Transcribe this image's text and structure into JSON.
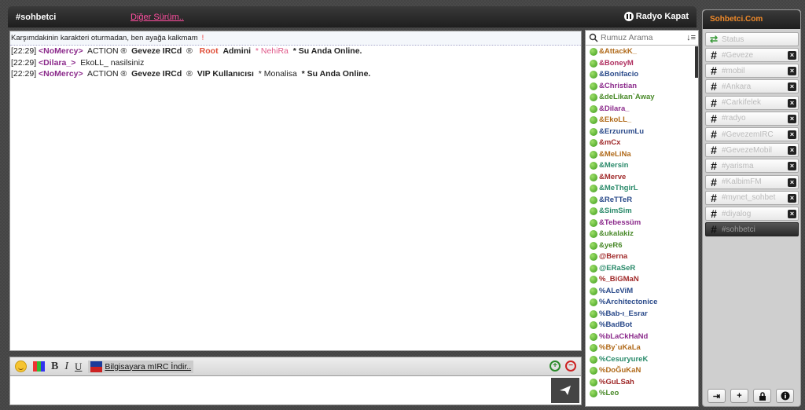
{
  "header": {
    "channel": "#sohbetci",
    "other_version": "Diğer Sürüm..",
    "radio_label": "Radyo Kapat"
  },
  "chat": {
    "topic": "Karşımdakinin karakteri oturmadan, ben ayağa kalkmam",
    "topic_mark": "!",
    "messages": [
      {
        "time": "[22:29]",
        "nick": "<NoMercy>",
        "parts": [
          "ACTION ®",
          "Geveze IRCd",
          "®",
          "Root",
          "Admini",
          "* NehiRa",
          "* Su Anda Online."
        ]
      },
      {
        "time": "[22:29]",
        "nick": "<Dilara_>",
        "text": "EkoLL_ nasilsiniz"
      },
      {
        "time": "[22:29]",
        "nick": "<NoMercy>",
        "parts": [
          "ACTION ®",
          "Geveze IRCd",
          "®",
          "VIP Kullanıcısı",
          "* Monalisa",
          "* Su Anda Online."
        ]
      }
    ]
  },
  "toolbar": {
    "bold": "B",
    "italic": "I",
    "underline": "U",
    "mirc_link": "Bilgisayara mIRC İndir..",
    "zoom_in": "+",
    "zoom_out": "−"
  },
  "input": {
    "value": ""
  },
  "users": {
    "search_placeholder": "Rumuz Arama",
    "list": [
      {
        "name": "&AttackK_",
        "color": "#b06a1a"
      },
      {
        "name": "&BoneyM",
        "color": "#b03060"
      },
      {
        "name": "&Bonifacio",
        "color": "#2a4a8a"
      },
      {
        "name": "&Christian",
        "color": "#8b2a8b"
      },
      {
        "name": "&deLikan`Away",
        "color": "#4a8a2a"
      },
      {
        "name": "&Dilara_",
        "color": "#8b2a8b"
      },
      {
        "name": "&EkoLL_",
        "color": "#b06a1a"
      },
      {
        "name": "&ErzurumLu",
        "color": "#2a4a8a"
      },
      {
        "name": "&mCx",
        "color": "#a02a2a"
      },
      {
        "name": "&MeLiNa",
        "color": "#b06a1a"
      },
      {
        "name": "&Mersin",
        "color": "#2a8a6a"
      },
      {
        "name": "&Merve",
        "color": "#a02a2a"
      },
      {
        "name": "&MeThgirL",
        "color": "#2a8a6a"
      },
      {
        "name": "&ReTTeR",
        "color": "#2a4a8a"
      },
      {
        "name": "&SimSim",
        "color": "#2a8a6a"
      },
      {
        "name": "&Tebessüm",
        "color": "#8b2a8b"
      },
      {
        "name": "&ukalakiz",
        "color": "#4a8a2a"
      },
      {
        "name": "&yeR6",
        "color": "#4a8a2a"
      },
      {
        "name": "@Berna",
        "color": "#a02a2a"
      },
      {
        "name": "@ERaSeR",
        "color": "#2a8a6a"
      },
      {
        "name": "%_BiGMaN",
        "color": "#a02a2a"
      },
      {
        "name": "%ALeViM",
        "color": "#2a4a8a"
      },
      {
        "name": "%Architectonice",
        "color": "#2a4a8a"
      },
      {
        "name": "%Bab-ı_Esrar",
        "color": "#2a4a8a"
      },
      {
        "name": "%BadBot",
        "color": "#2a4a8a"
      },
      {
        "name": "%bLaCkHaNd",
        "color": "#8b2a8b"
      },
      {
        "name": "%By`uKaLa",
        "color": "#b06a1a"
      },
      {
        "name": "%CesuryureK",
        "color": "#2a8a6a"
      },
      {
        "name": "%DoĞuKaN",
        "color": "#b06a1a"
      },
      {
        "name": "%GuLSah",
        "color": "#a02a2a"
      },
      {
        "name": "%Leo",
        "color": "#4a8a2a"
      }
    ]
  },
  "side": {
    "title": "Sohbetci.Com",
    "status_label": "Status",
    "channels": [
      {
        "name": "#Geveze",
        "active": false
      },
      {
        "name": "#mobil",
        "active": false
      },
      {
        "name": "#Ankara",
        "active": false
      },
      {
        "name": "#Carkifelek",
        "active": false
      },
      {
        "name": "#radyo",
        "active": false
      },
      {
        "name": "#GevezemIRC",
        "active": false
      },
      {
        "name": "#GevezeMobil",
        "active": false
      },
      {
        "name": "#yarisma",
        "active": false
      },
      {
        "name": "#KalbimFM",
        "active": false
      },
      {
        "name": "#mynet_sohbet",
        "active": false
      },
      {
        "name": "#diyalog",
        "active": false
      },
      {
        "name": "#sohbetci",
        "active": true
      }
    ]
  }
}
